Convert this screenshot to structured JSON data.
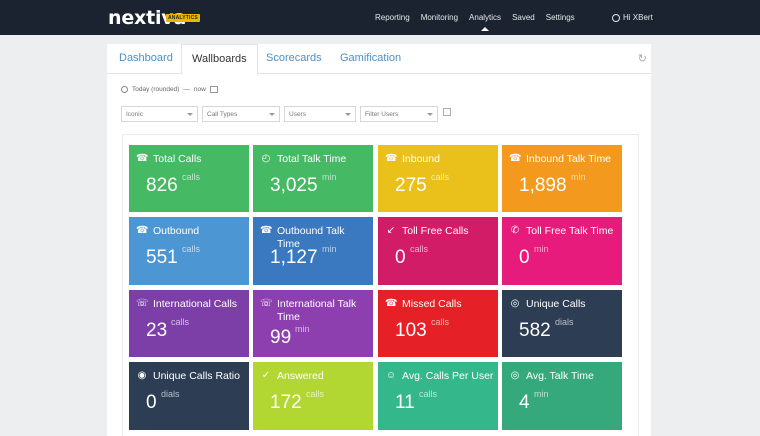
{
  "app": {
    "logo": "nextiva",
    "logo_badge": "ANALYTICS"
  },
  "topnav": {
    "links": [
      "Reporting",
      "Monitoring",
      "Analytics",
      "Saved",
      "Settings"
    ],
    "active": "Analytics",
    "user_label": "Hi XBert"
  },
  "tabs": {
    "items": [
      "Dashboard",
      "Wallboards",
      "Scorecards",
      "Gamification"
    ],
    "active": "Wallboards"
  },
  "daterange": {
    "label": "Today (rounded)",
    "sep": "—",
    "end": "now"
  },
  "filters": [
    "Iconic",
    "Call Types",
    "Users",
    "Filter Users"
  ],
  "tiles": [
    {
      "title": "Total Calls",
      "value": "826",
      "unit": "calls",
      "color": "#45b964",
      "icon": "phone-incoming-icon"
    },
    {
      "title": "Total Talk Time",
      "value": "3,025",
      "unit": "min",
      "color": "#45b964",
      "icon": "clock-phone-icon"
    },
    {
      "title": "Inbound",
      "value": "275",
      "unit": "calls",
      "color": "#e9c11a",
      "icon": "phone-inbound-icon"
    },
    {
      "title": "Inbound Talk Time",
      "value": "1,898",
      "unit": "min",
      "color": "#f39a1e",
      "icon": "inbound-talk-icon"
    },
    {
      "title": "Outbound",
      "value": "551",
      "unit": "calls",
      "color": "#4c97d3",
      "icon": "phone-outbound-icon"
    },
    {
      "title": "Outbound Talk Time",
      "value": "1,127",
      "unit": "min",
      "color": "#3a78bf",
      "icon": "outbound-talk-icon"
    },
    {
      "title": "Toll Free Calls",
      "value": "0",
      "unit": "calls",
      "color": "#d31c67",
      "icon": "toll-free-icon"
    },
    {
      "title": "Toll Free Talk Time",
      "value": "0",
      "unit": "min",
      "color": "#e61b7c",
      "icon": "toll-free-talk-icon"
    },
    {
      "title": "International Calls",
      "value": "23",
      "unit": "calls",
      "color": "#7c3fa7",
      "icon": "international-icon"
    },
    {
      "title": "International Talk Time",
      "value": "99",
      "unit": "min",
      "color": "#8d3fb0",
      "icon": "international-talk-icon"
    },
    {
      "title": "Missed Calls",
      "value": "103",
      "unit": "calls",
      "color": "#e52127",
      "icon": "missed-calls-icon"
    },
    {
      "title": "Unique Calls",
      "value": "582",
      "unit": "dials",
      "color": "#2d3e54",
      "icon": "fingerprint-icon"
    },
    {
      "title": "Unique Calls Ratio",
      "value": "0",
      "unit": "dials",
      "color": "#2d3e54",
      "icon": "ratio-icon"
    },
    {
      "title": "Answered",
      "value": "172",
      "unit": "calls",
      "color": "#b3d732",
      "icon": "answered-icon"
    },
    {
      "title": "Avg. Calls Per User",
      "value": "11",
      "unit": "calls",
      "color": "#35b78c",
      "icon": "user-calls-icon"
    },
    {
      "title": "Avg. Talk Time",
      "value": "4",
      "unit": "min",
      "color": "#35a97b",
      "icon": "target-icon"
    }
  ]
}
